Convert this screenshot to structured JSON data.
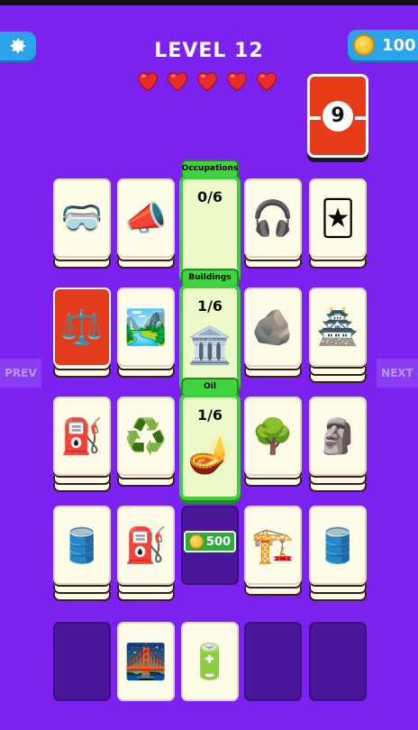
{
  "header": {
    "level_label": "LEVEL 12",
    "coins": "100",
    "lives": 5,
    "remaining_count": "9"
  },
  "nav": {
    "prev": "PREV",
    "next": "NEXT"
  },
  "categories": [
    {
      "label": "Occupations",
      "count": "0/6",
      "icon": ""
    },
    {
      "label": "Buildings",
      "count": "1/6",
      "icon": "🏛️"
    },
    {
      "label": "Oil",
      "count": "1/6",
      "icon": "🪔"
    }
  ],
  "cards": {
    "row1": [
      "🥽",
      "📣",
      "🎧",
      "🃏"
    ],
    "row2": [
      "⚖️",
      "🏞️",
      "🪨",
      "🏯"
    ],
    "row3": [
      "⛽",
      "♻️",
      "🌳",
      "🗿"
    ],
    "row4": [
      "🛢️",
      "⛽",
      "🏗️",
      "🛢️"
    ],
    "row5": [
      "🌉",
      "🔋"
    ]
  },
  "unlock_price": "500",
  "colors": {
    "background": "#7c22f0",
    "category_green": "#3fd43f",
    "accent_blue": "#2aa3e8",
    "card_red": "#e33b1c"
  }
}
